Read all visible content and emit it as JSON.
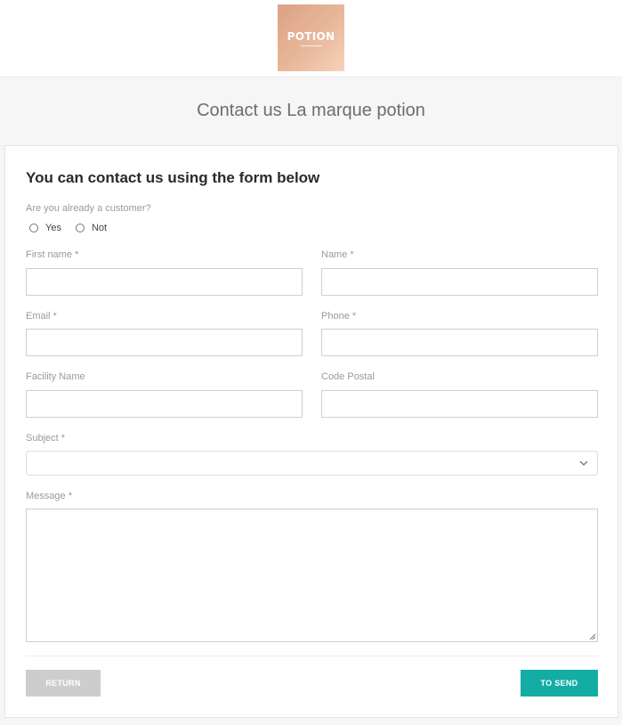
{
  "brand": {
    "logo_text": "POTION"
  },
  "page": {
    "title": "Contact us La marque potion"
  },
  "form": {
    "heading": "You can contact us using the form below",
    "customer_question": "Are you already a customer?",
    "options": [
      "Yes",
      "Not"
    ],
    "fields": {
      "first_name": {
        "label": "First name *",
        "value": ""
      },
      "name": {
        "label": "Name *",
        "value": ""
      },
      "email": {
        "label": "Email *",
        "value": ""
      },
      "phone": {
        "label": "Phone *",
        "value": ""
      },
      "facility_name": {
        "label": "Facility Name",
        "value": ""
      },
      "code_postal": {
        "label": "Code Postal",
        "value": ""
      },
      "subject": {
        "label": "Subject *",
        "value": ""
      },
      "message": {
        "label": "Message *",
        "value": ""
      }
    },
    "buttons": {
      "return": "RETURN",
      "send": "TO SEND"
    }
  },
  "colors": {
    "accent": "#14ada4",
    "muted_button": "#cdcdcd",
    "logo": "#e8b89b"
  },
  "icons": {
    "select": "chevron-down-icon",
    "textarea": "resize-handle-icon"
  }
}
